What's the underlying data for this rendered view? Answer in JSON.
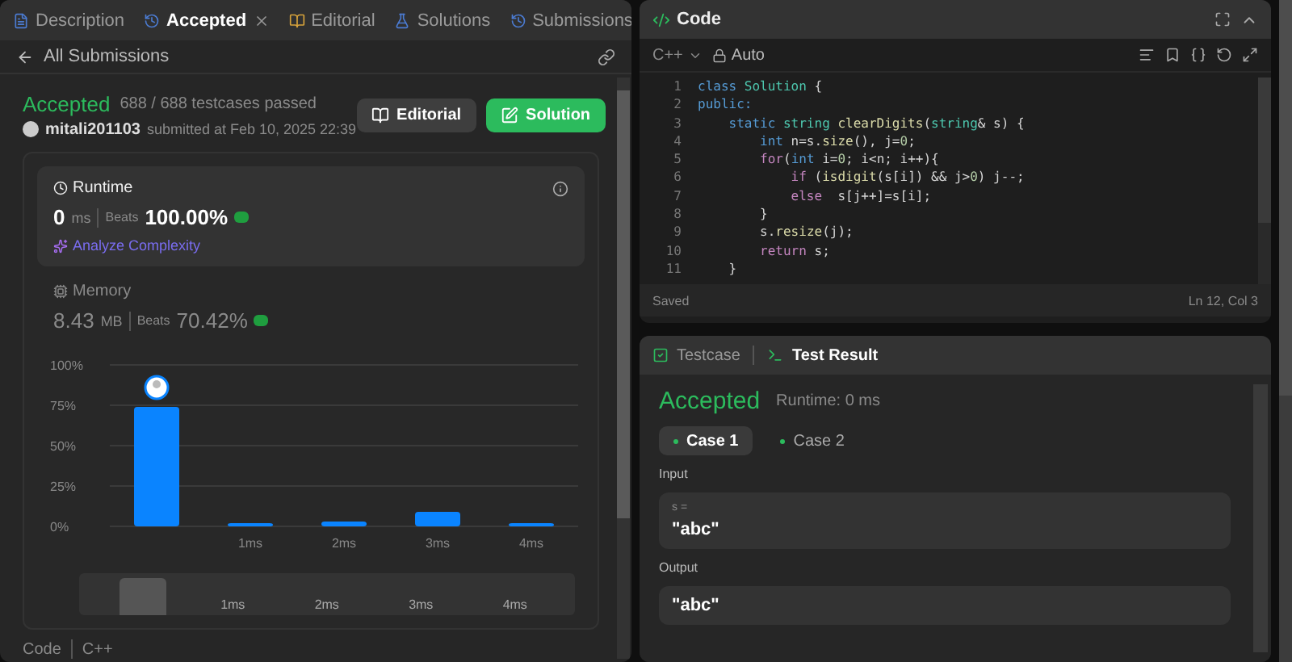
{
  "left_tabs": [
    {
      "label": "Description",
      "kind": "description",
      "selected": false,
      "closable": false
    },
    {
      "label": "Accepted",
      "kind": "history",
      "selected": true,
      "closable": true
    },
    {
      "label": "Editorial",
      "kind": "book",
      "selected": false,
      "closable": false
    },
    {
      "label": "Solutions",
      "kind": "flask",
      "selected": false,
      "closable": false
    },
    {
      "label": "Submissions",
      "kind": "history",
      "selected": false,
      "closable": false
    }
  ],
  "back_link": "All Submissions",
  "submission": {
    "status": "Accepted",
    "testcases": "688 / 688 testcases passed",
    "user": "mitali201103",
    "submitted": "submitted at Feb 10, 2025 22:39",
    "buttons": [
      {
        "label": "Editorial",
        "kind": "editorial"
      },
      {
        "label": "Solution",
        "kind": "solution"
      }
    ]
  },
  "runtime": {
    "title": "Runtime",
    "value": "0",
    "unit": "ms",
    "beats_label": "Beats",
    "beats": "100.00%",
    "analyze": "Analyze Complexity"
  },
  "memory": {
    "title": "Memory",
    "value": "8.43",
    "unit": "MB",
    "beats_label": "Beats",
    "beats": "70.42%"
  },
  "chart_data": {
    "type": "bar",
    "x": [
      0,
      1,
      2,
      3,
      4
    ],
    "values": [
      74,
      2,
      3,
      9,
      2
    ],
    "xlim": [
      -0.5,
      4.5
    ],
    "grid": true,
    "ylim": [
      0,
      100
    ],
    "xticks": [
      {
        "value": 1,
        "label": "1ms"
      },
      {
        "value": 2,
        "label": "2ms"
      },
      {
        "value": 3,
        "label": "3ms"
      },
      {
        "value": 4,
        "label": "4ms"
      }
    ],
    "yticks": [
      {
        "value": 0,
        "label": "0%"
      },
      {
        "value": 25,
        "label": "25%"
      },
      {
        "value": 50,
        "label": "50%"
      },
      {
        "value": 75,
        "label": "75%"
      },
      {
        "value": 100,
        "label": "100%"
      }
    ]
  },
  "navigator": {
    "labels": [
      "1ms",
      "2ms",
      "3ms",
      "4ms"
    ]
  },
  "code_footer": {
    "label": "Code",
    "language": "C++"
  },
  "editor": {
    "title": "Code",
    "language": "C++",
    "mode": "Auto",
    "status": "Saved",
    "position": "Ln 12, Col 3",
    "lines": [
      {
        "num": "1",
        "tokens": [
          {
            "t": "class ",
            "kind": "keyword"
          },
          {
            "t": "Solution",
            "kind": "type"
          },
          {
            "t": " {",
            "kind": "plain"
          }
        ]
      },
      {
        "num": "2",
        "tokens": [
          {
            "t": "public:",
            "kind": "keyword"
          }
        ]
      },
      {
        "num": "3",
        "tokens": [
          {
            "t": "    static ",
            "kind": "keyword"
          },
          {
            "t": "string ",
            "kind": "type"
          },
          {
            "t": "clearDigits",
            "kind": "func"
          },
          {
            "t": "(",
            "kind": "plain"
          },
          {
            "t": "string",
            "kind": "type"
          },
          {
            "t": "& s) {",
            "kind": "plain"
          }
        ]
      },
      {
        "num": "4",
        "tokens": [
          {
            "t": "        int ",
            "kind": "keyword"
          },
          {
            "t": "n=s.",
            "kind": "plain"
          },
          {
            "t": "size",
            "kind": "func"
          },
          {
            "t": "(), j=",
            "kind": "plain"
          },
          {
            "t": "0",
            "kind": "number"
          },
          {
            "t": ";",
            "kind": "plain"
          }
        ]
      },
      {
        "num": "5",
        "tokens": [
          {
            "t": "        for",
            "kind": "control"
          },
          {
            "t": "(",
            "kind": "plain"
          },
          {
            "t": "int ",
            "kind": "keyword"
          },
          {
            "t": "i=",
            "kind": "plain"
          },
          {
            "t": "0",
            "kind": "number"
          },
          {
            "t": "; i<n; i++){",
            "kind": "plain"
          }
        ]
      },
      {
        "num": "6",
        "tokens": [
          {
            "t": "            if ",
            "kind": "control"
          },
          {
            "t": "(",
            "kind": "plain"
          },
          {
            "t": "isdigit",
            "kind": "func"
          },
          {
            "t": "(s[i]) && j>",
            "kind": "plain"
          },
          {
            "t": "0",
            "kind": "number"
          },
          {
            "t": ") j--;",
            "kind": "plain"
          }
        ]
      },
      {
        "num": "7",
        "tokens": [
          {
            "t": "            else ",
            "kind": "control"
          },
          {
            "t": " s[j++]=s[i];",
            "kind": "plain"
          }
        ]
      },
      {
        "num": "8",
        "tokens": [
          {
            "t": "        }",
            "kind": "plain"
          }
        ]
      },
      {
        "num": "9",
        "tokens": [
          {
            "t": "        s.",
            "kind": "plain"
          },
          {
            "t": "resize",
            "kind": "func"
          },
          {
            "t": "(j);",
            "kind": "plain"
          }
        ]
      },
      {
        "num": "10",
        "tokens": [
          {
            "t": "        return ",
            "kind": "control"
          },
          {
            "t": "s;",
            "kind": "plain"
          }
        ]
      },
      {
        "num": "11",
        "tokens": [
          {
            "t": "    }",
            "kind": "plain"
          }
        ]
      }
    ]
  },
  "test_tabs": [
    {
      "label": "Testcase",
      "kind": "testcase",
      "selected": false
    },
    {
      "label": "Test Result",
      "kind": "terminal",
      "selected": true
    }
  ],
  "result": {
    "status": "Accepted",
    "runtime": "Runtime: 0 ms",
    "cases": [
      {
        "label": "Case 1",
        "selected": true
      },
      {
        "label": "Case 2",
        "selected": false
      }
    ],
    "input_label": "Input",
    "input_var": "s =",
    "input_value": "\"abc\"",
    "output_label": "Output",
    "output_value": "\"abc\""
  }
}
